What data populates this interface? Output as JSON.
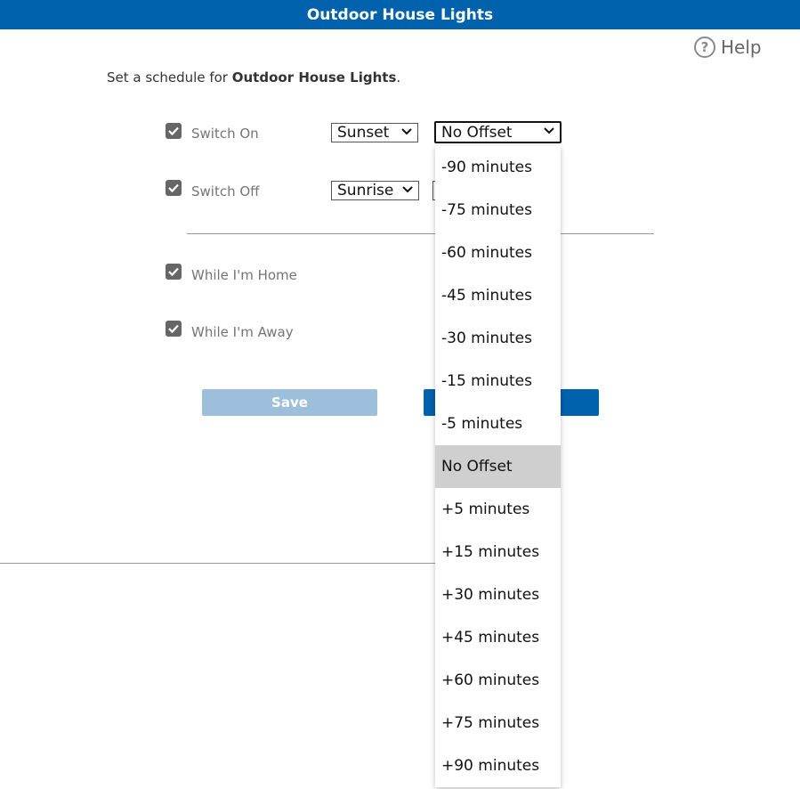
{
  "window": {
    "title": "Outdoor House Lights"
  },
  "help": {
    "icon": "help-circle-icon",
    "label": "Help",
    "glyph": "?"
  },
  "intro": {
    "prefix": "Set a schedule for ",
    "device": "Outdoor House Lights",
    "suffix": "."
  },
  "schedule": {
    "switch_on": {
      "label": "Switch On",
      "checked": true,
      "trigger": "Sunset",
      "offset": "No Offset"
    },
    "switch_off": {
      "label": "Switch Off",
      "checked": true,
      "trigger": "Sunrise"
    }
  },
  "presence": {
    "home": {
      "label": "While I'm Home",
      "checked": true
    },
    "away": {
      "label": "While I'm Away",
      "checked": true
    }
  },
  "buttons": {
    "save": "Save"
  },
  "offset_options": [
    "-90 minutes",
    "-75 minutes",
    "-60 minutes",
    "-45 minutes",
    "-30 minutes",
    "-15 minutes",
    "-5 minutes",
    "No Offset",
    "+5 minutes",
    "+15 minutes",
    "+30 minutes",
    "+45 minutes",
    "+60 minutes",
    "+75 minutes",
    "+90 minutes"
  ],
  "selected_offset": "No Offset",
  "colors": {
    "brand": "#0061ad",
    "save_disabled": "#9dbfdc",
    "checkbox": "#666666",
    "selected_option": "#cfcfcf"
  }
}
